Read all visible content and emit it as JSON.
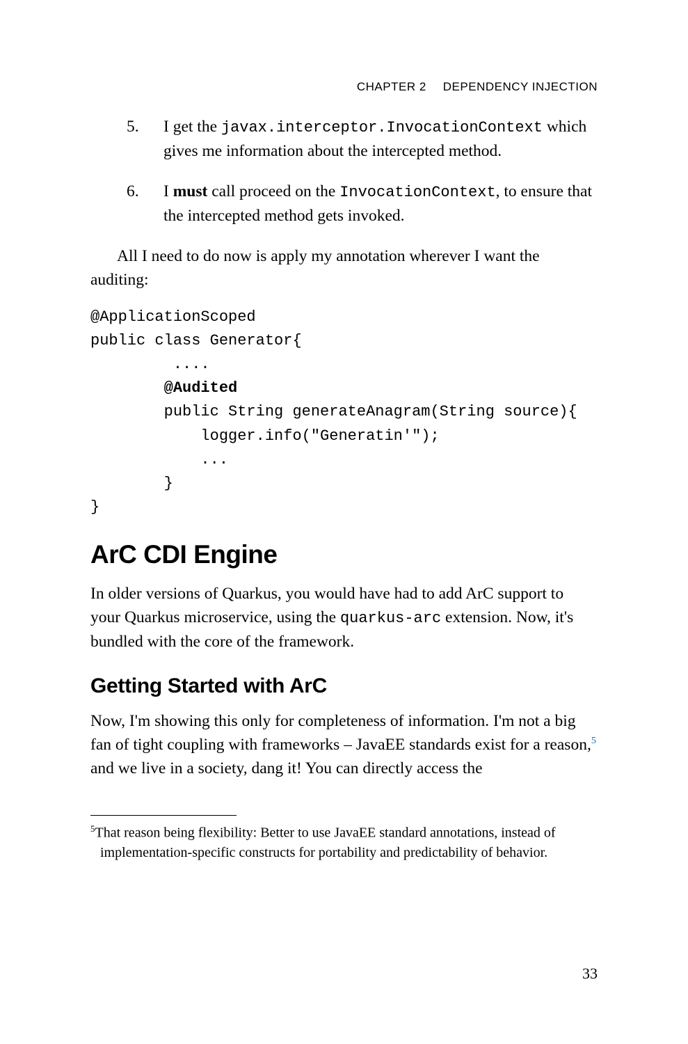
{
  "header": {
    "chapter": "CHAPTER 2",
    "title": "DEPENDENCY INJECTION"
  },
  "list": {
    "item5": {
      "num": "5.",
      "pre": "I get the ",
      "code": "javax.interceptor.InvocationContext",
      "post": " which gives me information about the intercepted method."
    },
    "item6": {
      "num": "6.",
      "pre": "I ",
      "bold": "must",
      "mid": " call proceed on the ",
      "code": "InvocationContext",
      "post": ", to ensure that the intercepted method gets invoked."
    }
  },
  "para1": "All I need to do now is apply my annotation wherever I want the auditing:",
  "code": {
    "l1": "@ApplicationScoped",
    "l2": "public class Generator{",
    "l3": "         ....",
    "l4": "        @Audited",
    "l5": "        public String generateAnagram(String source){",
    "l6": "            logger.info(\"Generatin'\");",
    "l7": "            ...",
    "l8": "        }",
    "l9": "}"
  },
  "h2": "ArC CDI Engine",
  "para2": {
    "pre": "In older versions of Quarkus, you would have had to add ArC support to your Quarkus microservice, using the ",
    "code": "quarkus-arc",
    "post": " extension. Now, it's bundled with the core of the framework."
  },
  "h3": "Getting Started with ArC",
  "para3": {
    "pre": "Now, I'm showing this only for completeness of information. I'm not a big fan of tight coupling with frameworks – JavaEE standards exist for a reason,",
    "fn": "5",
    "post": " and we live in a society, dang it! You can directly access the"
  },
  "footnote": {
    "num": "5",
    "text": "That reason being flexibility: Better to use JavaEE standard annotations, instead of implementation-specific constructs for portability and predictability of behavior."
  },
  "pageNumber": "33"
}
